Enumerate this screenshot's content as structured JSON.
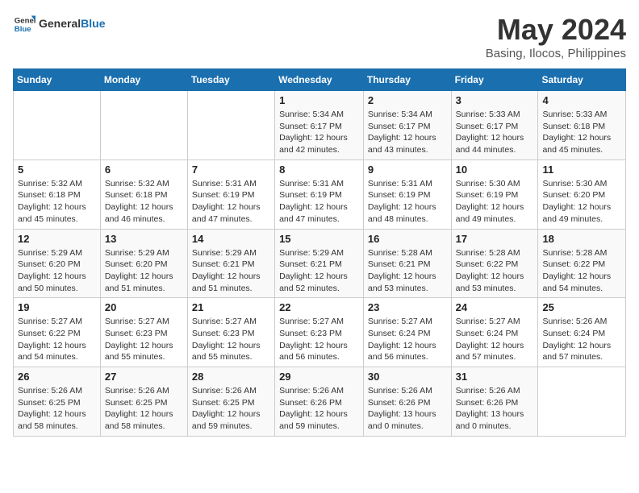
{
  "header": {
    "logo_line1": "General",
    "logo_line2": "Blue",
    "month": "May 2024",
    "location": "Basing, Ilocos, Philippines"
  },
  "weekdays": [
    "Sunday",
    "Monday",
    "Tuesday",
    "Wednesday",
    "Thursday",
    "Friday",
    "Saturday"
  ],
  "weeks": [
    [
      {
        "day": "",
        "info": ""
      },
      {
        "day": "",
        "info": ""
      },
      {
        "day": "",
        "info": ""
      },
      {
        "day": "1",
        "info": "Sunrise: 5:34 AM\nSunset: 6:17 PM\nDaylight: 12 hours\nand 42 minutes."
      },
      {
        "day": "2",
        "info": "Sunrise: 5:34 AM\nSunset: 6:17 PM\nDaylight: 12 hours\nand 43 minutes."
      },
      {
        "day": "3",
        "info": "Sunrise: 5:33 AM\nSunset: 6:17 PM\nDaylight: 12 hours\nand 44 minutes."
      },
      {
        "day": "4",
        "info": "Sunrise: 5:33 AM\nSunset: 6:18 PM\nDaylight: 12 hours\nand 45 minutes."
      }
    ],
    [
      {
        "day": "5",
        "info": "Sunrise: 5:32 AM\nSunset: 6:18 PM\nDaylight: 12 hours\nand 45 minutes."
      },
      {
        "day": "6",
        "info": "Sunrise: 5:32 AM\nSunset: 6:18 PM\nDaylight: 12 hours\nand 46 minutes."
      },
      {
        "day": "7",
        "info": "Sunrise: 5:31 AM\nSunset: 6:19 PM\nDaylight: 12 hours\nand 47 minutes."
      },
      {
        "day": "8",
        "info": "Sunrise: 5:31 AM\nSunset: 6:19 PM\nDaylight: 12 hours\nand 47 minutes."
      },
      {
        "day": "9",
        "info": "Sunrise: 5:31 AM\nSunset: 6:19 PM\nDaylight: 12 hours\nand 48 minutes."
      },
      {
        "day": "10",
        "info": "Sunrise: 5:30 AM\nSunset: 6:19 PM\nDaylight: 12 hours\nand 49 minutes."
      },
      {
        "day": "11",
        "info": "Sunrise: 5:30 AM\nSunset: 6:20 PM\nDaylight: 12 hours\nand 49 minutes."
      }
    ],
    [
      {
        "day": "12",
        "info": "Sunrise: 5:29 AM\nSunset: 6:20 PM\nDaylight: 12 hours\nand 50 minutes."
      },
      {
        "day": "13",
        "info": "Sunrise: 5:29 AM\nSunset: 6:20 PM\nDaylight: 12 hours\nand 51 minutes."
      },
      {
        "day": "14",
        "info": "Sunrise: 5:29 AM\nSunset: 6:21 PM\nDaylight: 12 hours\nand 51 minutes."
      },
      {
        "day": "15",
        "info": "Sunrise: 5:29 AM\nSunset: 6:21 PM\nDaylight: 12 hours\nand 52 minutes."
      },
      {
        "day": "16",
        "info": "Sunrise: 5:28 AM\nSunset: 6:21 PM\nDaylight: 12 hours\nand 53 minutes."
      },
      {
        "day": "17",
        "info": "Sunrise: 5:28 AM\nSunset: 6:22 PM\nDaylight: 12 hours\nand 53 minutes."
      },
      {
        "day": "18",
        "info": "Sunrise: 5:28 AM\nSunset: 6:22 PM\nDaylight: 12 hours\nand 54 minutes."
      }
    ],
    [
      {
        "day": "19",
        "info": "Sunrise: 5:27 AM\nSunset: 6:22 PM\nDaylight: 12 hours\nand 54 minutes."
      },
      {
        "day": "20",
        "info": "Sunrise: 5:27 AM\nSunset: 6:23 PM\nDaylight: 12 hours\nand 55 minutes."
      },
      {
        "day": "21",
        "info": "Sunrise: 5:27 AM\nSunset: 6:23 PM\nDaylight: 12 hours\nand 55 minutes."
      },
      {
        "day": "22",
        "info": "Sunrise: 5:27 AM\nSunset: 6:23 PM\nDaylight: 12 hours\nand 56 minutes."
      },
      {
        "day": "23",
        "info": "Sunrise: 5:27 AM\nSunset: 6:24 PM\nDaylight: 12 hours\nand 56 minutes."
      },
      {
        "day": "24",
        "info": "Sunrise: 5:27 AM\nSunset: 6:24 PM\nDaylight: 12 hours\nand 57 minutes."
      },
      {
        "day": "25",
        "info": "Sunrise: 5:26 AM\nSunset: 6:24 PM\nDaylight: 12 hours\nand 57 minutes."
      }
    ],
    [
      {
        "day": "26",
        "info": "Sunrise: 5:26 AM\nSunset: 6:25 PM\nDaylight: 12 hours\nand 58 minutes."
      },
      {
        "day": "27",
        "info": "Sunrise: 5:26 AM\nSunset: 6:25 PM\nDaylight: 12 hours\nand 58 minutes."
      },
      {
        "day": "28",
        "info": "Sunrise: 5:26 AM\nSunset: 6:25 PM\nDaylight: 12 hours\nand 59 minutes."
      },
      {
        "day": "29",
        "info": "Sunrise: 5:26 AM\nSunset: 6:26 PM\nDaylight: 12 hours\nand 59 minutes."
      },
      {
        "day": "30",
        "info": "Sunrise: 5:26 AM\nSunset: 6:26 PM\nDaylight: 13 hours\nand 0 minutes."
      },
      {
        "day": "31",
        "info": "Sunrise: 5:26 AM\nSunset: 6:26 PM\nDaylight: 13 hours\nand 0 minutes."
      },
      {
        "day": "",
        "info": ""
      }
    ]
  ]
}
